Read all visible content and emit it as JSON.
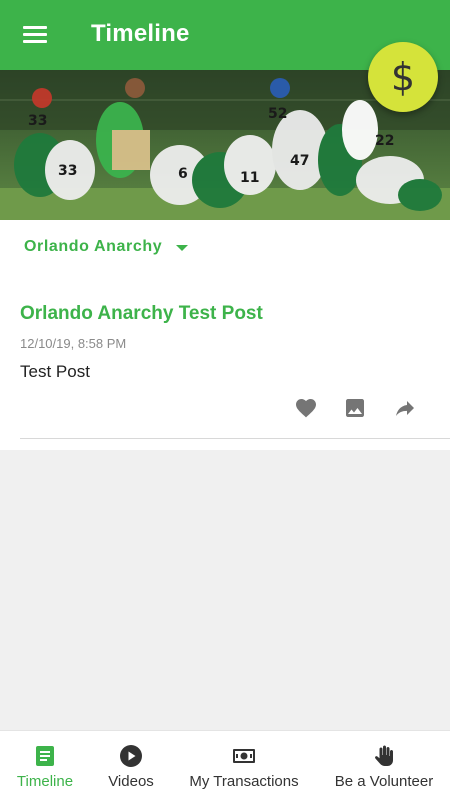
{
  "appbar": {
    "title": "Timeline",
    "menu_icon": "menu-icon"
  },
  "fab": {
    "glyph": "$",
    "icon": "dollar-icon",
    "color": "#d5e33a"
  },
  "team_select": {
    "value": "Orlando Anarchy"
  },
  "post": {
    "title": "Orlando Anarchy Test Post",
    "date": "12/10/19, 8:58 PM",
    "body": "Test Post",
    "actions": [
      "heart-icon",
      "image-icon",
      "share-icon"
    ]
  },
  "bottom_nav": {
    "items": [
      {
        "label": "Timeline",
        "icon": "timeline-icon",
        "active": true
      },
      {
        "label": "Videos",
        "icon": "play-icon",
        "active": false
      },
      {
        "label": "My Transactions",
        "icon": "money-icon",
        "active": false
      },
      {
        "label": "Be a Volunteer",
        "icon": "hand-icon",
        "active": false
      }
    ]
  },
  "colors": {
    "primary": "#3db34a",
    "accent": "#d5e33a",
    "background": "#f0f0f0"
  }
}
